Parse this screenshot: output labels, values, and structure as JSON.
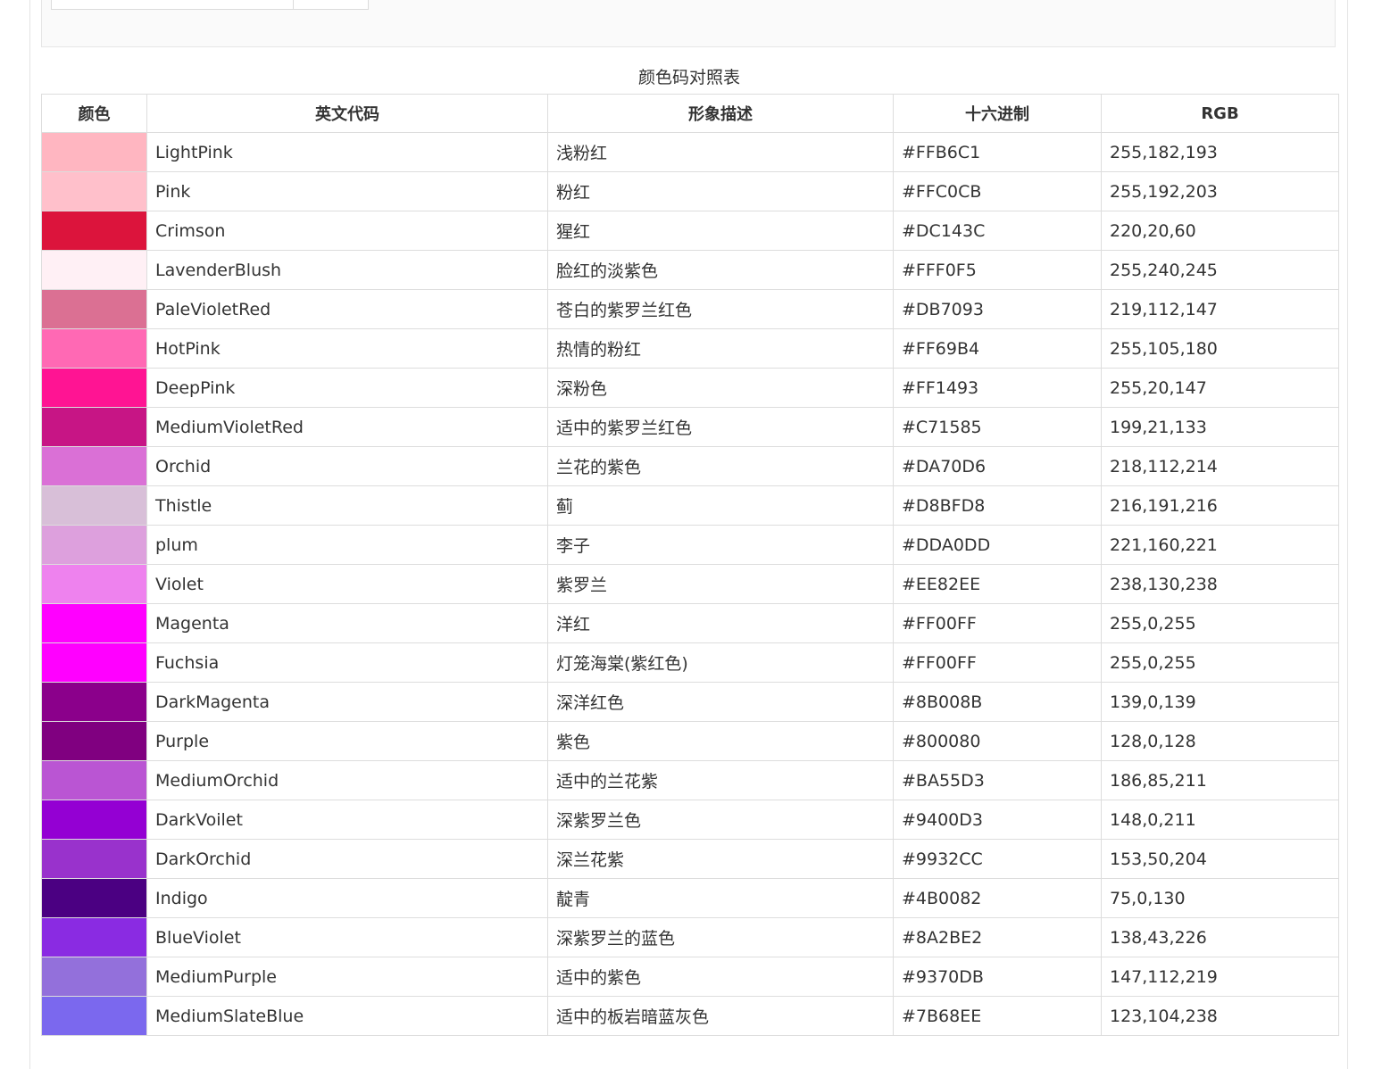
{
  "caption": "颜色码对照表",
  "headers": {
    "color": "颜色",
    "name": "英文代码",
    "desc": "形象描述",
    "hex": "十六进制",
    "rgb": "RGB"
  },
  "rows": [
    {
      "color": "#FFB6C1",
      "name": "LightPink",
      "desc": "浅粉红",
      "hex": "#FFB6C1",
      "rgb": "255,182,193"
    },
    {
      "color": "#FFC0CB",
      "name": "Pink",
      "desc": "粉红",
      "hex": "#FFC0CB",
      "rgb": "255,192,203"
    },
    {
      "color": "#DC143C",
      "name": "Crimson",
      "desc": "猩红",
      "hex": "#DC143C",
      "rgb": "220,20,60"
    },
    {
      "color": "#FFF0F5",
      "name": "LavenderBlush",
      "desc": "脸红的淡紫色",
      "hex": "#FFF0F5",
      "rgb": "255,240,245"
    },
    {
      "color": "#DB7093",
      "name": "PaleVioletRed",
      "desc": "苍白的紫罗兰红色",
      "hex": "#DB7093",
      "rgb": "219,112,147"
    },
    {
      "color": "#FF69B4",
      "name": "HotPink",
      "desc": "热情的粉红",
      "hex": "#FF69B4",
      "rgb": "255,105,180"
    },
    {
      "color": "#FF1493",
      "name": "DeepPink",
      "desc": "深粉色",
      "hex": "#FF1493",
      "rgb": "255,20,147"
    },
    {
      "color": "#C71585",
      "name": "MediumVioletRed",
      "desc": "适中的紫罗兰红色",
      "hex": "#C71585",
      "rgb": "199,21,133"
    },
    {
      "color": "#DA70D6",
      "name": "Orchid",
      "desc": "兰花的紫色",
      "hex": "#DA70D6",
      "rgb": "218,112,214"
    },
    {
      "color": "#D8BFD8",
      "name": "Thistle",
      "desc": "蓟",
      "hex": "#D8BFD8",
      "rgb": "216,191,216"
    },
    {
      "color": "#DDA0DD",
      "name": "plum",
      "desc": "李子",
      "hex": "#DDA0DD",
      "rgb": "221,160,221"
    },
    {
      "color": "#EE82EE",
      "name": "Violet",
      "desc": "紫罗兰",
      "hex": "#EE82EE",
      "rgb": "238,130,238"
    },
    {
      "color": "#FF00FF",
      "name": "Magenta",
      "desc": "洋红",
      "hex": "#FF00FF",
      "rgb": "255,0,255"
    },
    {
      "color": "#FF00FF",
      "name": "Fuchsia",
      "desc": "灯笼海棠(紫红色)",
      "hex": "#FF00FF",
      "rgb": "255,0,255"
    },
    {
      "color": "#8B008B",
      "name": "DarkMagenta",
      "desc": "深洋红色",
      "hex": "#8B008B",
      "rgb": "139,0,139"
    },
    {
      "color": "#800080",
      "name": "Purple",
      "desc": "紫色",
      "hex": "#800080",
      "rgb": "128,0,128"
    },
    {
      "color": "#BA55D3",
      "name": "MediumOrchid",
      "desc": "适中的兰花紫",
      "hex": "#BA55D3",
      "rgb": "186,85,211"
    },
    {
      "color": "#9400D3",
      "name": "DarkVoilet",
      "desc": "深紫罗兰色",
      "hex": "#9400D3",
      "rgb": "148,0,211"
    },
    {
      "color": "#9932CC",
      "name": "DarkOrchid",
      "desc": "深兰花紫",
      "hex": "#9932CC",
      "rgb": "153,50,204"
    },
    {
      "color": "#4B0082",
      "name": "Indigo",
      "desc": "靛青",
      "hex": "#4B0082",
      "rgb": "75,0,130"
    },
    {
      "color": "#8A2BE2",
      "name": "BlueViolet",
      "desc": "深紫罗兰的蓝色",
      "hex": "#8A2BE2",
      "rgb": "138,43,226"
    },
    {
      "color": "#9370DB",
      "name": "MediumPurple",
      "desc": "适中的紫色",
      "hex": "#9370DB",
      "rgb": "147,112,219"
    },
    {
      "color": "#7B68EE",
      "name": "MediumSlateBlue",
      "desc": "适中的板岩暗蓝灰色",
      "hex": "#7B68EE",
      "rgb": "123,104,238"
    }
  ]
}
